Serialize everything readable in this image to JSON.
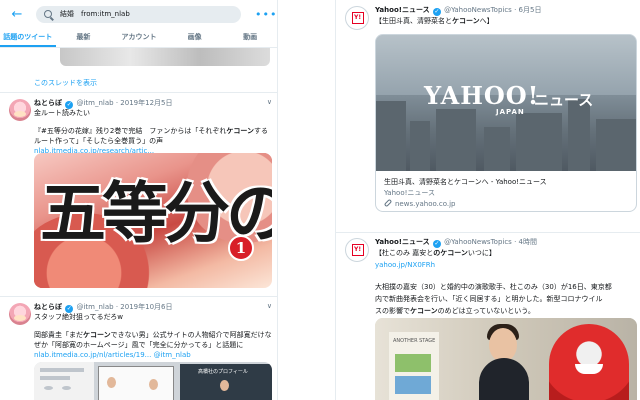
{
  "left": {
    "search": {
      "query": "結婚　from:itm_nlab",
      "placeholder": ""
    },
    "tabs": [
      "話題のツイート",
      "最新",
      "アカウント",
      "画像",
      "動画"
    ],
    "thread_link": "このスレッドを表示",
    "tweets": [
      {
        "name": "ねとらぼ",
        "handle": "@itm_nlab",
        "date": "2019年12月5日",
        "line1": "金ルート読みたい",
        "line2a": "『#五等分の花嫁』残り2巻で完結　ファンからは「それぞれ",
        "line2b": "ケコーン",
        "line2c": "するルート作って」「そしたら全巻買う」の声",
        "link": "nlab.itmedia.co.jp/research/artic...",
        "image_text": "五等分の",
        "image_volume": "1"
      },
      {
        "name": "ねとらぼ",
        "handle": "@itm_nlab",
        "date": "2019年10月6日",
        "line1": "スタッフ絶対狙ってるだろw",
        "line2a": "岡部貴圭「まだ",
        "line2b": "ケコーン",
        "line2c": "できない男」公式サイトの人物紹介で阿部寛だけなぜか「阿部寛のホームページ」風で「完全に分かってる」と話題に",
        "link": "nlab.itmedia.co.jp/nl/articles/19...",
        "link_suffix": "@itm_nlab",
        "image_text": "高橋社のプロフィール"
      }
    ]
  },
  "right": {
    "tweets": [
      {
        "name": "Yahoo!ニュース",
        "handle": "@YahooNewsTopics",
        "date": "6月5日",
        "text_a": "【生田斗真、清野菜名と",
        "text_b": "ケコーン",
        "text_c": "へ】",
        "card_logo": "YAHOO!",
        "card_logo_sub": "JAPAN",
        "card_logo_news": "ニュース",
        "card_title": "生田斗真、清野菜名とケコーンへ - Yahoo!ニュース",
        "card_source": "Yahoo!ニュース",
        "card_url": "news.yahoo.co.jp"
      },
      {
        "name": "Yahoo!ニュース",
        "handle": "@YahooNewsTopics",
        "date": "4時間",
        "line1a": "【杜このみ 嘉安と",
        "line1b": "のケコーン",
        "line1c": "いつに】",
        "link": "yahoo.jp/NX0FRh",
        "body1": "大相撲の嘉安（30）と婚約中の演歌歌手、杜このみ（30）が16日、東京都",
        "body2": "内で新曲発表会を行い、「近く同居する」と明かした。新型コロナウイル",
        "body3a": "スの影響で",
        "body3b": "ケコーン",
        "body3c": "のめどは立っていないという。",
        "photo_panel": "ANOTHER STAGE"
      }
    ]
  },
  "colors": {
    "accent": "#1da1f2",
    "text": "#14171a",
    "muted": "#657786",
    "border": "#e6ecf0"
  }
}
